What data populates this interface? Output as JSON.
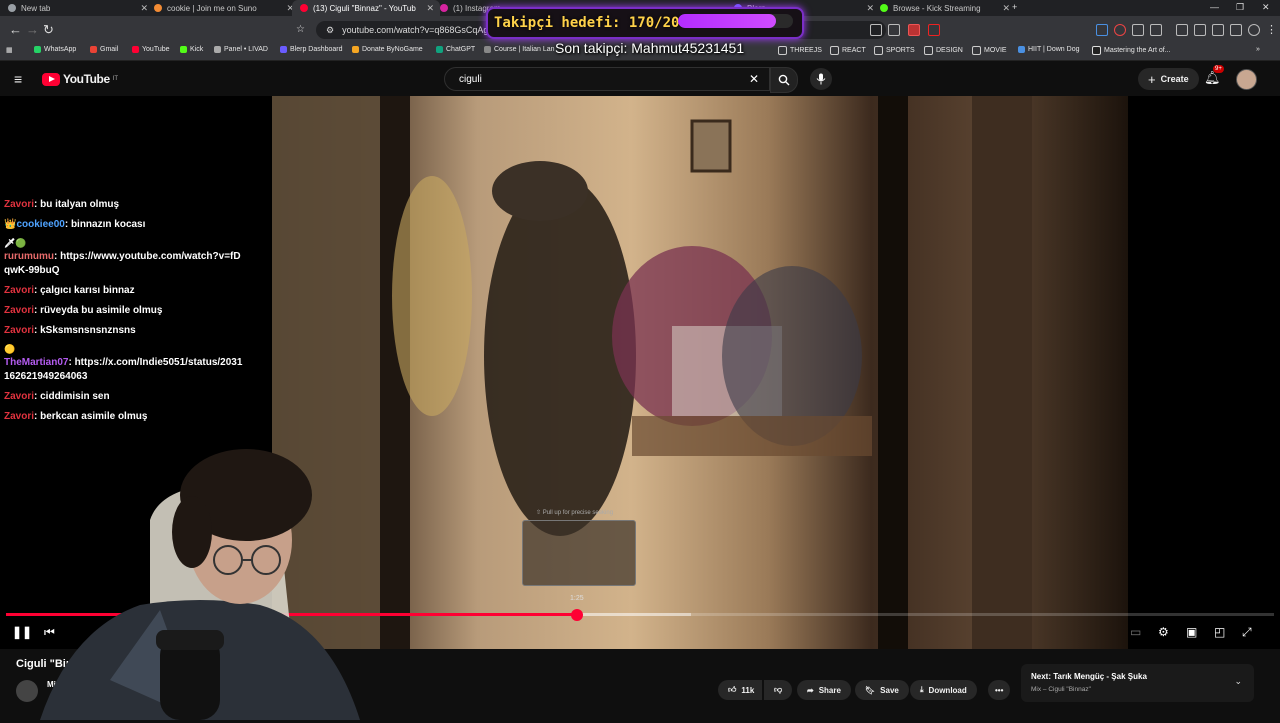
{
  "browser": {
    "tabs": [
      {
        "label": "New tab",
        "color": "#9aa0a6"
      },
      {
        "label": "cookie | Join me on Suno",
        "color": "#f28b34"
      },
      {
        "label": "(13) Ciguli \"Binnaz\" - YouTub",
        "color": "#ff0033",
        "active": true
      },
      {
        "label": "(1) Instagram",
        "color": "#d6249f"
      },
      {
        "label": "Blerp",
        "color": "#6a5cff"
      },
      {
        "label": "Browse - Kick Streaming",
        "color": "#53fc18"
      }
    ],
    "url": "youtube.com/watch?v=q868GsCqAgA&list",
    "bookmarks": [
      "WhatsApp",
      "Gmail",
      "YouTube",
      "Kick",
      "Panel • LIVAD",
      "Blerp Dashboard",
      "Donate ByNoGame",
      "ChatGPT",
      "Course | Italian Lan",
      "THREEJS",
      "REACT",
      "SPORTS",
      "DESIGN",
      "MOVIE",
      "HIIT | Down Dog",
      "Mastering the Art of..."
    ]
  },
  "overlay": {
    "follow_goal_label": "Takipçi hedefi: 170/200",
    "follow_goal_progress": 0.85,
    "last_follower": "Son takipçi: Mahmut45231451"
  },
  "youtube": {
    "region": "IT",
    "search_query": "ciguli",
    "create_label": "Create",
    "notifications": "9+"
  },
  "chat": [
    {
      "user": "Zavori",
      "color": "#e0333f",
      "text": "bu italyan olmuş"
    },
    {
      "user": "cookiee00",
      "color": "#4fa3ff",
      "text": "binnazın kocası",
      "badge": "👑"
    },
    {
      "user": "rurumumu",
      "color": "#e86b6b",
      "text": "https://www.youtube.com/watch?v=fDqwK-99buQ",
      "badge": "🗡🟢"
    },
    {
      "user": "Zavori",
      "color": "#e0333f",
      "text": "çalgıcı karısı binnaz"
    },
    {
      "user": "Zavori",
      "color": "#e0333f",
      "text": "rüveyda bu asimile olmuş"
    },
    {
      "user": "Zavori",
      "color": "#e0333f",
      "text": "kSksmsnsnsnznsns"
    },
    {
      "user": "TheMartian07",
      "color": "#b45cf0",
      "text": "https://x.com/Indie5051/status/2031162621949264063",
      "badge": "🟡"
    },
    {
      "user": "Zavori",
      "color": "#e0333f",
      "text": "ciddimisin sen"
    },
    {
      "user": "Zavori",
      "color": "#e0333f",
      "text": "berkcan asimile olmuş"
    }
  ],
  "player": {
    "seek_hint": "⇧ Pull up for precise seeking",
    "seek_time": "1:25",
    "progress": 0.45,
    "buffered": 0.54
  },
  "video": {
    "title": "Ciguli \"Binn",
    "channel": "Mi",
    "likes": "11k",
    "share_label": "Share",
    "save_label": "Save",
    "download_label": "Download"
  },
  "next": {
    "title": "Next: Tarık Mengüç - Şak Şuka",
    "subtitle": "Mix – Ciguli \"Binnaz\""
  }
}
